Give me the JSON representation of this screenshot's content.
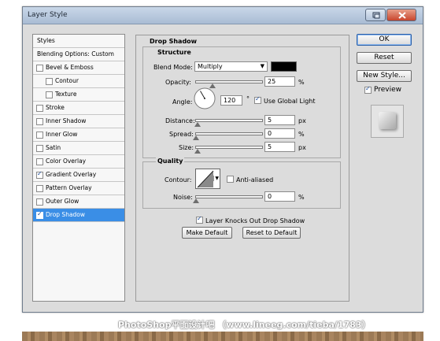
{
  "window": {
    "title": "Layer Style"
  },
  "styles_list": {
    "header": "Styles",
    "items": [
      {
        "label": "Blending Options: Custom",
        "checkbox": false,
        "checked": false,
        "indent": false,
        "selected": false
      },
      {
        "label": "Bevel & Emboss",
        "checkbox": true,
        "checked": false,
        "indent": false,
        "selected": false
      },
      {
        "label": "Contour",
        "checkbox": true,
        "checked": false,
        "indent": true,
        "selected": false
      },
      {
        "label": "Texture",
        "checkbox": true,
        "checked": false,
        "indent": true,
        "selected": false
      },
      {
        "label": "Stroke",
        "checkbox": true,
        "checked": false,
        "indent": false,
        "selected": false
      },
      {
        "label": "Inner Shadow",
        "checkbox": true,
        "checked": false,
        "indent": false,
        "selected": false
      },
      {
        "label": "Inner Glow",
        "checkbox": true,
        "checked": false,
        "indent": false,
        "selected": false
      },
      {
        "label": "Satin",
        "checkbox": true,
        "checked": false,
        "indent": false,
        "selected": false
      },
      {
        "label": "Color Overlay",
        "checkbox": true,
        "checked": false,
        "indent": false,
        "selected": false
      },
      {
        "label": "Gradient Overlay",
        "checkbox": true,
        "checked": true,
        "indent": false,
        "selected": false
      },
      {
        "label": "Pattern Overlay",
        "checkbox": true,
        "checked": false,
        "indent": false,
        "selected": false
      },
      {
        "label": "Outer Glow",
        "checkbox": true,
        "checked": false,
        "indent": false,
        "selected": false
      },
      {
        "label": "Drop Shadow",
        "checkbox": true,
        "checked": true,
        "indent": false,
        "selected": true
      }
    ]
  },
  "drop_shadow": {
    "section_title": "Drop Shadow",
    "structure": {
      "title": "Structure",
      "blend_mode": {
        "label": "Blend Mode:",
        "value": "Multiply",
        "color": "#000000"
      },
      "opacity": {
        "label": "Opacity:",
        "value": "25",
        "unit": "%",
        "fraction": 0.25
      },
      "angle": {
        "label": "Angle:",
        "value": "120",
        "unit": "°",
        "degrees": 120
      },
      "use_global_light": {
        "label": "Use Global Light",
        "checked": true
      },
      "distance": {
        "label": "Distance:",
        "value": "5",
        "unit": "px",
        "fraction": 0.02
      },
      "spread": {
        "label": "Spread:",
        "value": "0",
        "unit": "%",
        "fraction": 0.0
      },
      "size": {
        "label": "Size:",
        "value": "5",
        "unit": "px",
        "fraction": 0.02
      }
    },
    "quality": {
      "title": "Quality",
      "contour_label": "Contour:",
      "anti_aliased": {
        "label": "Anti-aliased",
        "checked": false
      },
      "noise": {
        "label": "Noise:",
        "value": "0",
        "unit": "%",
        "fraction": 0.0
      }
    },
    "knockout": {
      "label": "Layer Knocks Out Drop Shadow",
      "checked": true
    },
    "make_default": "Make Default",
    "reset_default": "Reset to Default"
  },
  "buttons": {
    "ok": "OK",
    "reset": "Reset",
    "new_style": "New Style...",
    "preview": {
      "label": "Preview",
      "checked": true
    }
  },
  "watermark": "PhotoShop平面设计吧 （www.lineeg.com/tieba/1783）",
  "colors": {
    "selection": "#3a8ee6",
    "dialog_bg": "#dcdcdc"
  }
}
